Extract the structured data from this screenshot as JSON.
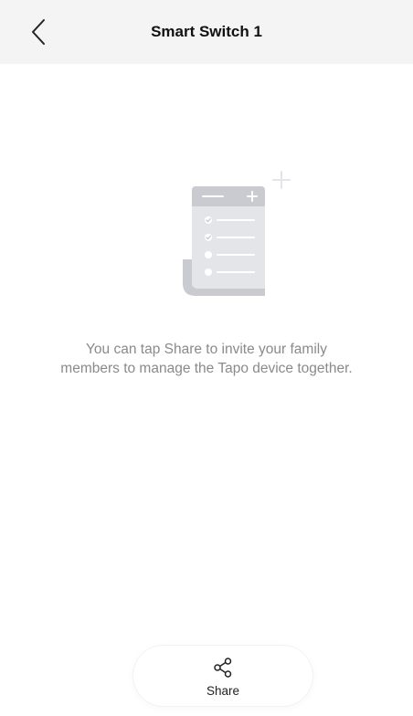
{
  "header": {
    "title": "Smart Switch 1",
    "back_icon": "chevron-left-icon"
  },
  "empty_state": {
    "illustration_icon": "checklist-document-icon",
    "message": "You can tap Share to invite your family members to manage the Tapo device together."
  },
  "share": {
    "icon": "share-icon",
    "label": "Share"
  },
  "colors": {
    "header_bg": "#f4f4f4",
    "illustration_main": "#c9cbd1",
    "illustration_light": "#e4e5e9",
    "message_text": "#8a8a8a"
  }
}
